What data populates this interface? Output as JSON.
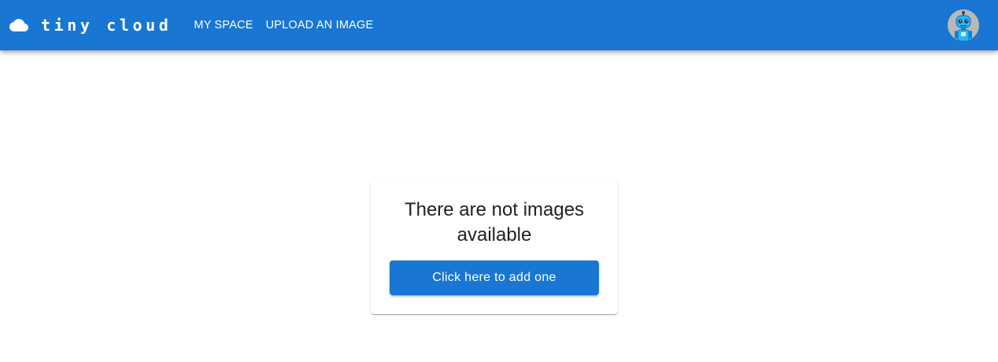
{
  "appbar": {
    "color": "#1976d2",
    "logo_icon": "cloud-icon",
    "brand_name": "tiny cloud",
    "nav": [
      {
        "label": "My Space"
      },
      {
        "label": "Upload an image"
      }
    ],
    "avatar_icon": "robot-avatar"
  },
  "empty_state": {
    "message": "There are not images available",
    "button_label": "Click here to add one",
    "button_color": "#1976d2"
  }
}
